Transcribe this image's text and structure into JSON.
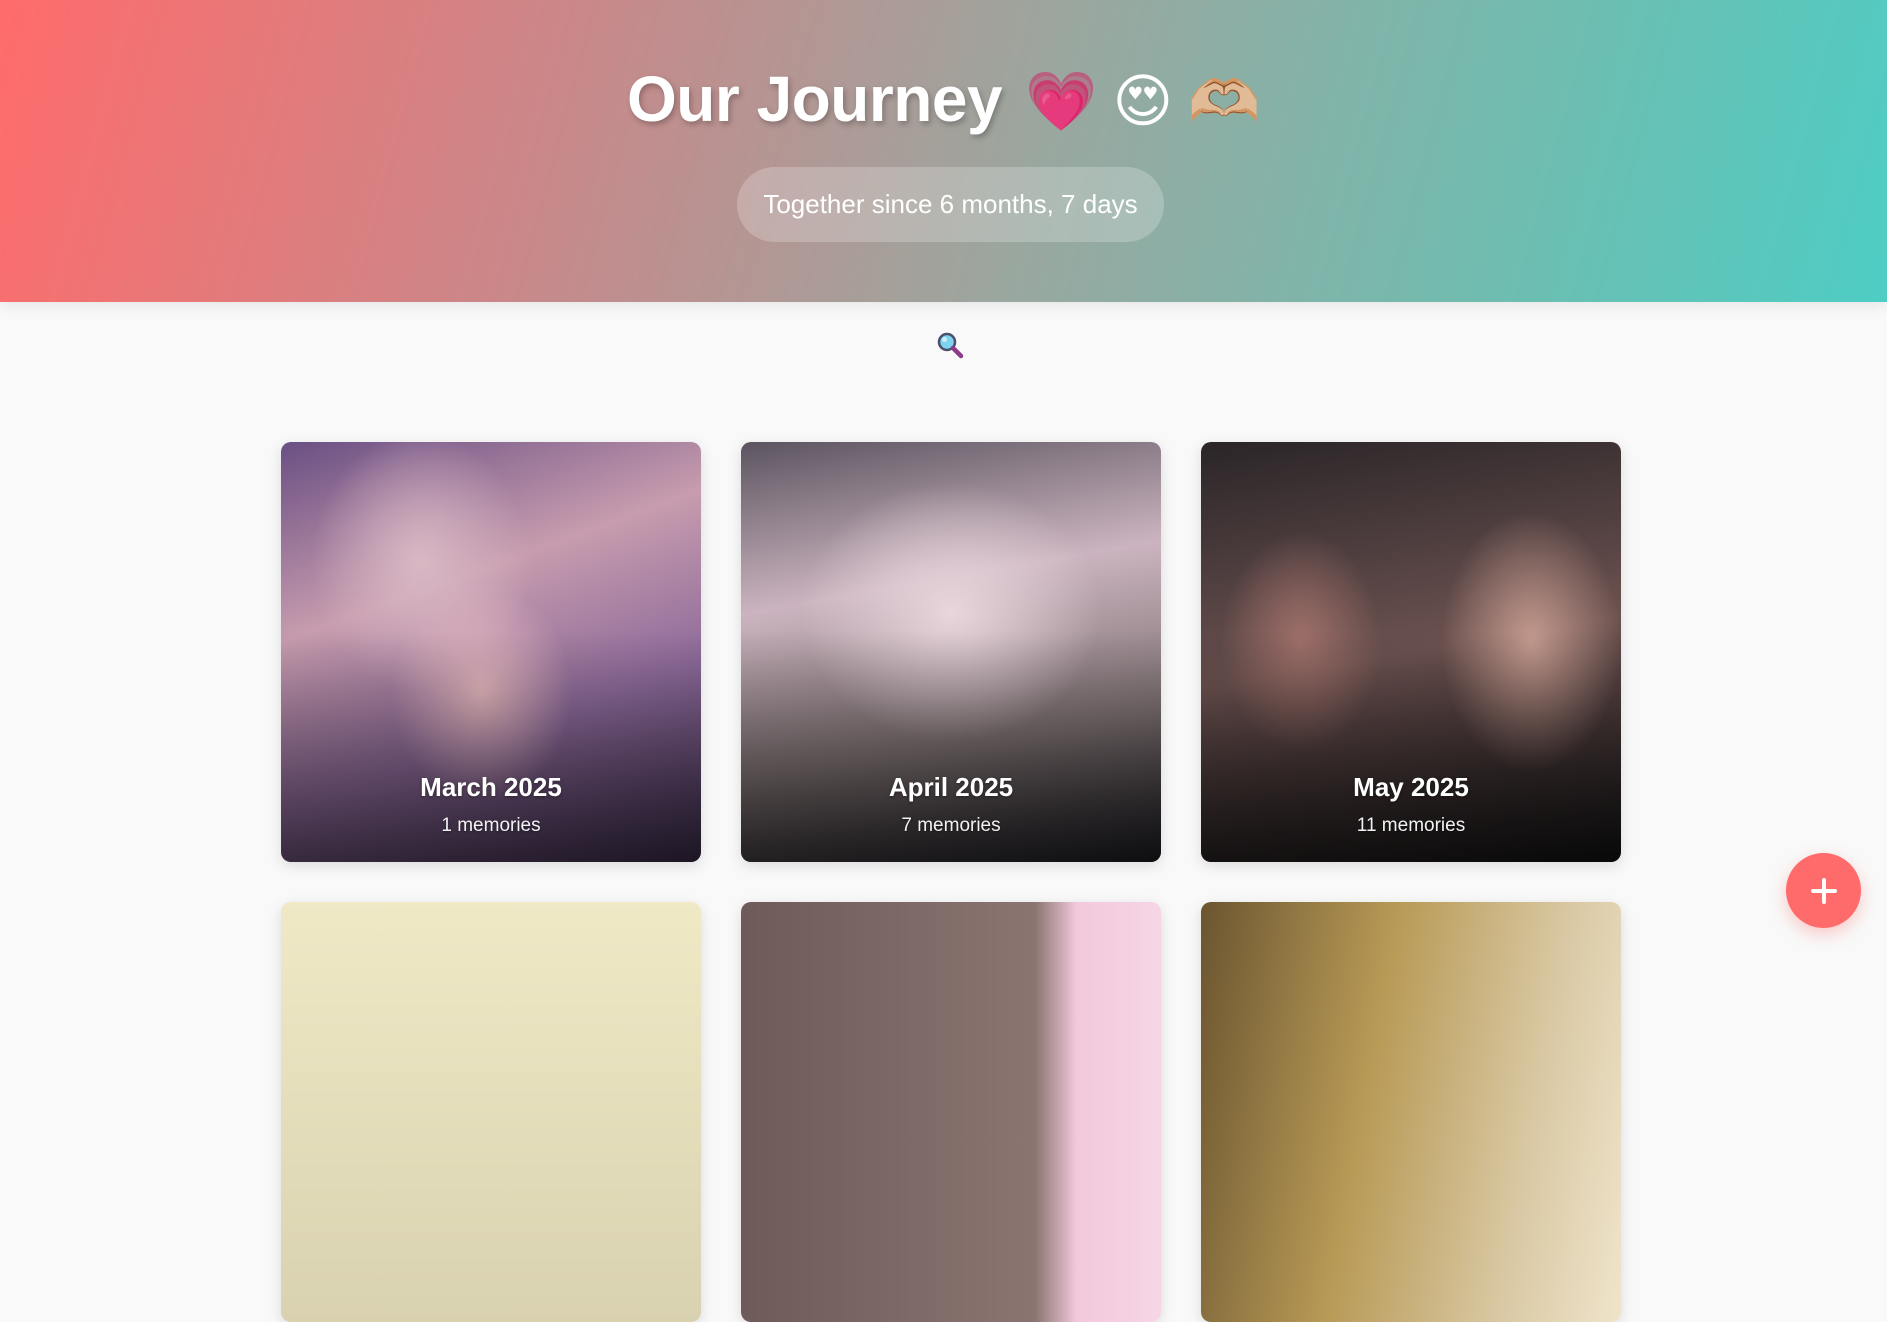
{
  "header": {
    "title": "Our Journey",
    "title_emojis": "💗 😍 🫶🏼",
    "together_text": "Together since 6 months, 7 days"
  },
  "search": {
    "icon": "search-icon"
  },
  "timeline": {
    "cards": [
      {
        "month": "March 2025",
        "count": "1 memories"
      },
      {
        "month": "April 2025",
        "count": "7 memories"
      },
      {
        "month": "May 2025",
        "count": "11 memories"
      },
      {
        "month": "",
        "count": ""
      },
      {
        "month": "",
        "count": ""
      },
      {
        "month": "",
        "count": ""
      }
    ]
  },
  "fab": {
    "label": "+",
    "icon": "plus-icon"
  },
  "colors": {
    "gradient_start": "#ff6b6b",
    "gradient_end": "#4ecdc4",
    "accent": "#ff6b6b",
    "background": "#f9f9f9"
  }
}
